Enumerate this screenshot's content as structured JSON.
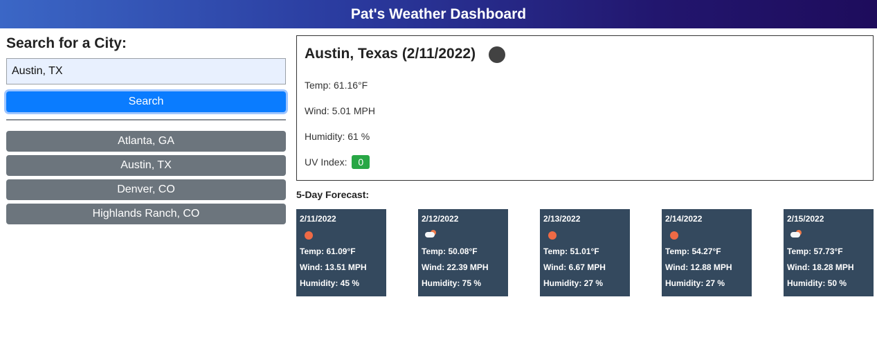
{
  "header": {
    "title": "Pat's Weather Dashboard"
  },
  "sidebar": {
    "heading": "Search for a City:",
    "search_value": "Austin, TX",
    "search_button": "Search",
    "history": [
      "Atlanta, GA",
      "Austin, TX",
      "Denver, CO",
      "Highlands Ranch, CO"
    ]
  },
  "current": {
    "title": "Austin, Texas (2/11/2022)",
    "icon": "clear-night-icon",
    "temp": "Temp: 61.16°F",
    "wind": "Wind: 5.01 MPH",
    "humidity": "Humidity: 61 %",
    "uv_label": "UV Index:",
    "uv_value": "0"
  },
  "forecast": {
    "title": "5-Day Forecast:",
    "days": [
      {
        "date": "2/11/2022",
        "icon": "sun-icon",
        "temp": "Temp: 61.09°F",
        "wind": "Wind: 13.51 MPH",
        "humidity": "Humidity: 45 %"
      },
      {
        "date": "2/12/2022",
        "icon": "partly-cloudy-icon",
        "temp": "Temp: 50.08°F",
        "wind": "Wind: 22.39 MPH",
        "humidity": "Humidity: 75 %"
      },
      {
        "date": "2/13/2022",
        "icon": "sun-icon",
        "temp": "Temp: 51.01°F",
        "wind": "Wind: 6.67 MPH",
        "humidity": "Humidity: 27 %"
      },
      {
        "date": "2/14/2022",
        "icon": "sun-icon",
        "temp": "Temp: 54.27°F",
        "wind": "Wind: 12.88 MPH",
        "humidity": "Humidity: 27 %"
      },
      {
        "date": "2/15/2022",
        "icon": "partly-cloudy-icon",
        "temp": "Temp: 57.73°F",
        "wind": "Wind: 18.28 MPH",
        "humidity": "Humidity: 50 %"
      }
    ]
  },
  "colors": {
    "header_gradient": [
      "#3b67c6",
      "#1e0c5c"
    ],
    "search_button": "#0a7cff",
    "history_button": "#6c757d",
    "uv_badge": "#28a745",
    "forecast_card": "#34495e"
  }
}
